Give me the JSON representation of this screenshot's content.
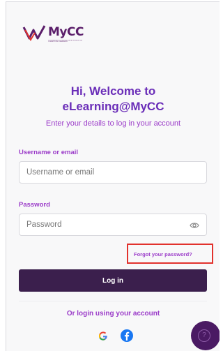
{
  "branding": {
    "logo_text": "MyCC",
    "logo_tagline": "SURUHANJAYA PERSAINGAN MALAYSIA MALAYSIA COMPETITION COMMISSION"
  },
  "welcome": {
    "title_line1": "Hi, Welcome to",
    "title_line2": "eLearning@MyCC",
    "subtitle": "Enter your details to log in your account"
  },
  "form": {
    "username_label": "Username or email",
    "username_placeholder": "Username or email",
    "password_label": "Password",
    "password_placeholder": "Password",
    "forgot_link": "Forgot your password?",
    "login_button": "Log in"
  },
  "social": {
    "divider_text": "Or login using your account",
    "providers": [
      "google-icon",
      "facebook-icon"
    ]
  },
  "help": {
    "icon": "help-icon",
    "symbol": "?"
  },
  "colors": {
    "brand_purple": "#6a2db8",
    "label_purple": "#9b3cc9",
    "button_dark": "#3b1f4d",
    "highlight_red": "#e2322d"
  }
}
